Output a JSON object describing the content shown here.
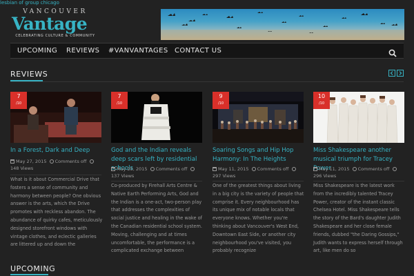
{
  "top_link": "lesbian of group chicago",
  "logo": {
    "top": "VANCOUVER",
    "main": "Vantage",
    "tagline": "CELEBRATING CULTURE & COMMUNITY"
  },
  "nav": {
    "items": [
      "UPCOMING",
      "REVIEWS",
      "#VANVANTAGES",
      "CONTACT US"
    ],
    "search_icon": "search-icon"
  },
  "reviews_section": {
    "title": "REVIEWS"
  },
  "upcoming_section": {
    "title": "UPCOMING"
  },
  "colors": {
    "accent": "#37b3c4",
    "score": "#d9302a",
    "background": "#222222",
    "nav": "#151515"
  },
  "reviews": [
    {
      "score": "7",
      "score_den": "/10",
      "title": "In a Forest, Dark and Deep",
      "date": "May 27, 2015",
      "comments": "Comments off",
      "views_num": "148",
      "views_label": "Views",
      "excerpt": "What is it about Commercial Drive that fosters a sense of community and harmony between people? One obvious answer is the arts, which the Drive promotes with reckless abandon. The abundance of quirky cafes, meticulously designed storefront windows with vintage clothes, and eclectic galleries are littered up and down the"
    },
    {
      "score": "7",
      "score_den": "/10",
      "title": "God and the Indian reveals deep scars left by residential schools",
      "date": "May 25, 2015",
      "comments": "Comments off",
      "views_num": "137",
      "views_label": "Views",
      "excerpt": "Co-produced by Firehall Arts Centre & Native Earth Performing Arts, God and the Indian is a one-act, two-person play that addresses the complexities of social justice and healing in the wake of the Canadian residential school system. Moving, challenging and at times uncomfortable, the performance is a complicated exchange between"
    },
    {
      "score": "9",
      "score_den": "/10",
      "title": "Soaring Songs and Hip Hop Harmony: In The Heights",
      "date": "May 11, 2015",
      "comments": "Comments off",
      "views_num": "297",
      "views_label": "Views",
      "excerpt": "One of the greatest things about living in a big city is the variety of people that comprise it. Every neighbourhood has its unique mix of notable locals that everyone knows. Whether you're thinking about Vancouver's West End, Downtown East Side, or another city neighbourhood you've visited, you probably recognize"
    },
    {
      "score": "10",
      "score_den": "/10",
      "title": "Miss Shakespeare another musical triumph for Tracey Power",
      "date": "May 11, 2015",
      "comments": "Comments off",
      "views_num": "296",
      "views_label": "Views",
      "excerpt": "Miss Shakespeare is the latest work from the incredibly talented Tracey Power, creator of the instant classic Chelsea Hotel. Miss Shakespeare tells the story of the Bard's daughter Judith Shakespeare and her close female friends, dubbed \"the Daring Gossips,\" Judith wants to express herself through art, like men do so"
    }
  ]
}
